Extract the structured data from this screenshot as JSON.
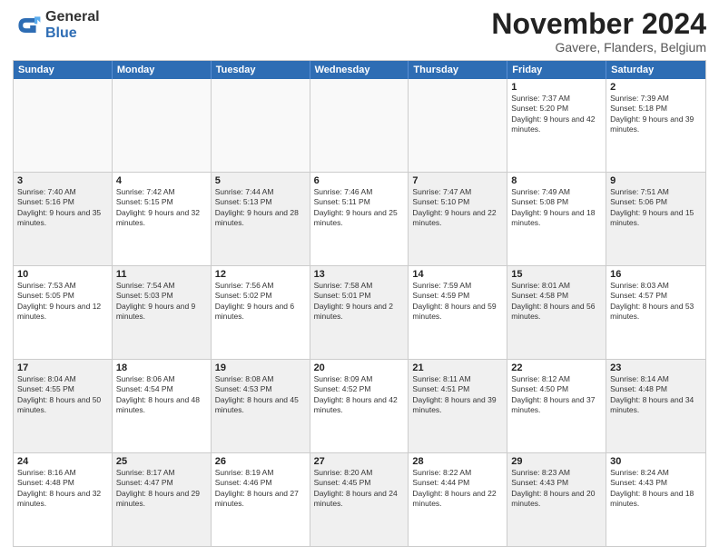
{
  "logo": {
    "general": "General",
    "blue": "Blue"
  },
  "title": "November 2024",
  "location": "Gavere, Flanders, Belgium",
  "header": {
    "days": [
      "Sunday",
      "Monday",
      "Tuesday",
      "Wednesday",
      "Thursday",
      "Friday",
      "Saturday"
    ]
  },
  "rows": [
    [
      {
        "day": "",
        "empty": true
      },
      {
        "day": "",
        "empty": true
      },
      {
        "day": "",
        "empty": true
      },
      {
        "day": "",
        "empty": true
      },
      {
        "day": "",
        "empty": true
      },
      {
        "day": "1",
        "sunrise": "Sunrise: 7:37 AM",
        "sunset": "Sunset: 5:20 PM",
        "daylight": "Daylight: 9 hours and 42 minutes."
      },
      {
        "day": "2",
        "sunrise": "Sunrise: 7:39 AM",
        "sunset": "Sunset: 5:18 PM",
        "daylight": "Daylight: 9 hours and 39 minutes."
      }
    ],
    [
      {
        "day": "3",
        "sunrise": "Sunrise: 7:40 AM",
        "sunset": "Sunset: 5:16 PM",
        "daylight": "Daylight: 9 hours and 35 minutes.",
        "shaded": true
      },
      {
        "day": "4",
        "sunrise": "Sunrise: 7:42 AM",
        "sunset": "Sunset: 5:15 PM",
        "daylight": "Daylight: 9 hours and 32 minutes."
      },
      {
        "day": "5",
        "sunrise": "Sunrise: 7:44 AM",
        "sunset": "Sunset: 5:13 PM",
        "daylight": "Daylight: 9 hours and 28 minutes.",
        "shaded": true
      },
      {
        "day": "6",
        "sunrise": "Sunrise: 7:46 AM",
        "sunset": "Sunset: 5:11 PM",
        "daylight": "Daylight: 9 hours and 25 minutes."
      },
      {
        "day": "7",
        "sunrise": "Sunrise: 7:47 AM",
        "sunset": "Sunset: 5:10 PM",
        "daylight": "Daylight: 9 hours and 22 minutes.",
        "shaded": true
      },
      {
        "day": "8",
        "sunrise": "Sunrise: 7:49 AM",
        "sunset": "Sunset: 5:08 PM",
        "daylight": "Daylight: 9 hours and 18 minutes."
      },
      {
        "day": "9",
        "sunrise": "Sunrise: 7:51 AM",
        "sunset": "Sunset: 5:06 PM",
        "daylight": "Daylight: 9 hours and 15 minutes.",
        "shaded": true
      }
    ],
    [
      {
        "day": "10",
        "sunrise": "Sunrise: 7:53 AM",
        "sunset": "Sunset: 5:05 PM",
        "daylight": "Daylight: 9 hours and 12 minutes."
      },
      {
        "day": "11",
        "sunrise": "Sunrise: 7:54 AM",
        "sunset": "Sunset: 5:03 PM",
        "daylight": "Daylight: 9 hours and 9 minutes.",
        "shaded": true
      },
      {
        "day": "12",
        "sunrise": "Sunrise: 7:56 AM",
        "sunset": "Sunset: 5:02 PM",
        "daylight": "Daylight: 9 hours and 6 minutes."
      },
      {
        "day": "13",
        "sunrise": "Sunrise: 7:58 AM",
        "sunset": "Sunset: 5:01 PM",
        "daylight": "Daylight: 9 hours and 2 minutes.",
        "shaded": true
      },
      {
        "day": "14",
        "sunrise": "Sunrise: 7:59 AM",
        "sunset": "Sunset: 4:59 PM",
        "daylight": "Daylight: 8 hours and 59 minutes."
      },
      {
        "day": "15",
        "sunrise": "Sunrise: 8:01 AM",
        "sunset": "Sunset: 4:58 PM",
        "daylight": "Daylight: 8 hours and 56 minutes.",
        "shaded": true
      },
      {
        "day": "16",
        "sunrise": "Sunrise: 8:03 AM",
        "sunset": "Sunset: 4:57 PM",
        "daylight": "Daylight: 8 hours and 53 minutes."
      }
    ],
    [
      {
        "day": "17",
        "sunrise": "Sunrise: 8:04 AM",
        "sunset": "Sunset: 4:55 PM",
        "daylight": "Daylight: 8 hours and 50 minutes.",
        "shaded": true
      },
      {
        "day": "18",
        "sunrise": "Sunrise: 8:06 AM",
        "sunset": "Sunset: 4:54 PM",
        "daylight": "Daylight: 8 hours and 48 minutes."
      },
      {
        "day": "19",
        "sunrise": "Sunrise: 8:08 AM",
        "sunset": "Sunset: 4:53 PM",
        "daylight": "Daylight: 8 hours and 45 minutes.",
        "shaded": true
      },
      {
        "day": "20",
        "sunrise": "Sunrise: 8:09 AM",
        "sunset": "Sunset: 4:52 PM",
        "daylight": "Daylight: 8 hours and 42 minutes."
      },
      {
        "day": "21",
        "sunrise": "Sunrise: 8:11 AM",
        "sunset": "Sunset: 4:51 PM",
        "daylight": "Daylight: 8 hours and 39 minutes.",
        "shaded": true
      },
      {
        "day": "22",
        "sunrise": "Sunrise: 8:12 AM",
        "sunset": "Sunset: 4:50 PM",
        "daylight": "Daylight: 8 hours and 37 minutes."
      },
      {
        "day": "23",
        "sunrise": "Sunrise: 8:14 AM",
        "sunset": "Sunset: 4:48 PM",
        "daylight": "Daylight: 8 hours and 34 minutes.",
        "shaded": true
      }
    ],
    [
      {
        "day": "24",
        "sunrise": "Sunrise: 8:16 AM",
        "sunset": "Sunset: 4:48 PM",
        "daylight": "Daylight: 8 hours and 32 minutes."
      },
      {
        "day": "25",
        "sunrise": "Sunrise: 8:17 AM",
        "sunset": "Sunset: 4:47 PM",
        "daylight": "Daylight: 8 hours and 29 minutes.",
        "shaded": true
      },
      {
        "day": "26",
        "sunrise": "Sunrise: 8:19 AM",
        "sunset": "Sunset: 4:46 PM",
        "daylight": "Daylight: 8 hours and 27 minutes."
      },
      {
        "day": "27",
        "sunrise": "Sunrise: 8:20 AM",
        "sunset": "Sunset: 4:45 PM",
        "daylight": "Daylight: 8 hours and 24 minutes.",
        "shaded": true
      },
      {
        "day": "28",
        "sunrise": "Sunrise: 8:22 AM",
        "sunset": "Sunset: 4:44 PM",
        "daylight": "Daylight: 8 hours and 22 minutes."
      },
      {
        "day": "29",
        "sunrise": "Sunrise: 8:23 AM",
        "sunset": "Sunset: 4:43 PM",
        "daylight": "Daylight: 8 hours and 20 minutes.",
        "shaded": true
      },
      {
        "day": "30",
        "sunrise": "Sunrise: 8:24 AM",
        "sunset": "Sunset: 4:43 PM",
        "daylight": "Daylight: 8 hours and 18 minutes."
      }
    ]
  ]
}
